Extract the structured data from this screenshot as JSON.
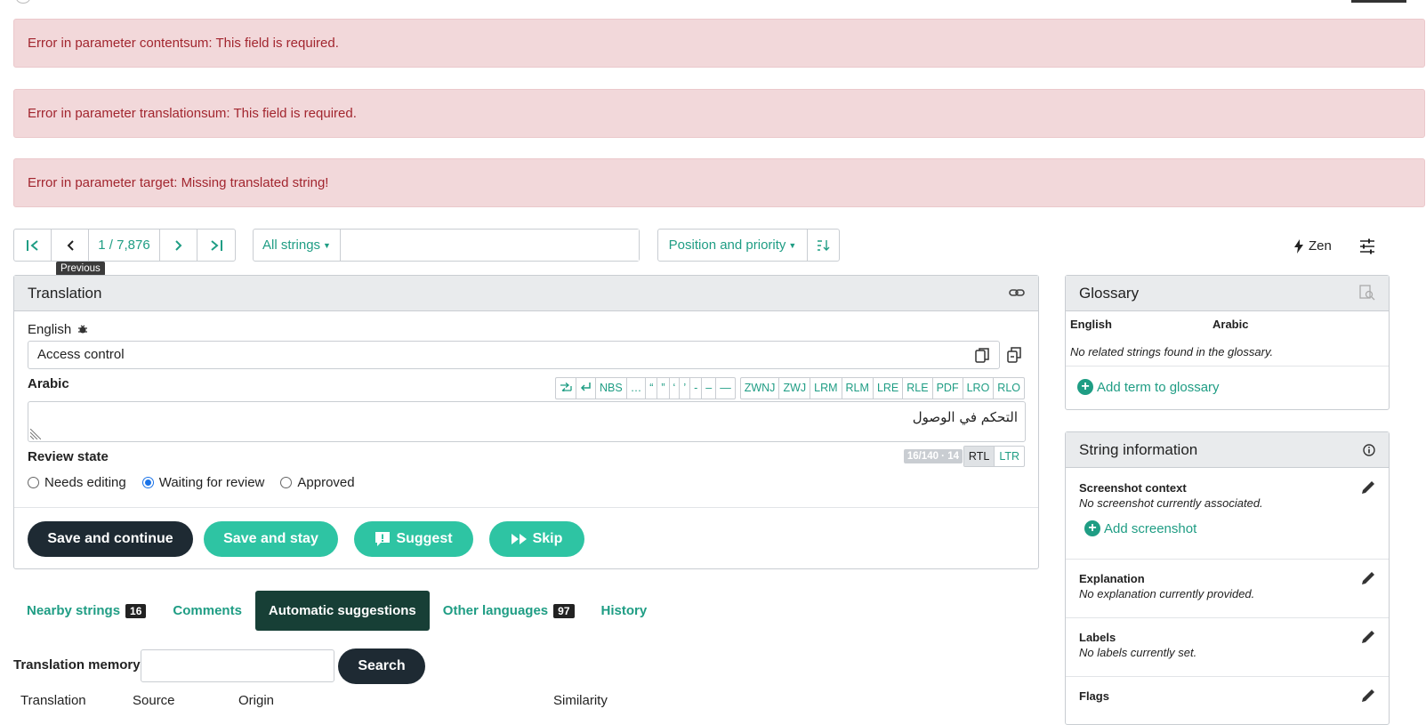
{
  "alerts": [
    "Error in parameter contentsum: This field is required.",
    "Error in parameter translationsum: This field is required.",
    "Error in parameter target: Missing translated string!"
  ],
  "pager": {
    "position": "1 / 7,876",
    "tooltip": "Previous"
  },
  "filter": {
    "label": "All strings",
    "query": ""
  },
  "sort": {
    "label": "Position and priority"
  },
  "zen": {
    "label": "Zen"
  },
  "translation": {
    "title": "Translation",
    "source_lang": "English",
    "source_text": "Access control",
    "target_lang": "Arabic",
    "target_text": "التحكم في الوصول",
    "special_chars": [
      "NBS",
      "…",
      "“",
      "”",
      "‘",
      "’",
      "-",
      "–",
      "—"
    ],
    "bidi_chars": [
      "ZWNJ",
      "ZWJ",
      "LRM",
      "RLM",
      "LRE",
      "RLE",
      "PDF",
      "LRO",
      "RLO"
    ],
    "counter": "16/140 · 14",
    "dir_rtl": "RTL",
    "dir_ltr": "LTR",
    "review_label": "Review state",
    "review_options": [
      "Needs editing",
      "Waiting for review",
      "Approved"
    ],
    "buttons": {
      "save_continue": "Save and continue",
      "save_stay": "Save and stay",
      "suggest": "Suggest",
      "skip": "Skip"
    }
  },
  "tabs": [
    {
      "label": "Nearby strings",
      "badge": "16"
    },
    {
      "label": "Comments",
      "badge": ""
    },
    {
      "label": "Automatic suggestions",
      "badge": ""
    },
    {
      "label": "Other languages",
      "badge": "97"
    },
    {
      "label": "History",
      "badge": ""
    }
  ],
  "memory": {
    "label": "Translation memory",
    "search_label": "Search",
    "columns": [
      "Translation",
      "Source",
      "Origin",
      "Similarity"
    ]
  },
  "glossary": {
    "title": "Glossary",
    "col_source": "English",
    "col_target": "Arabic",
    "empty": "No related strings found in the glossary.",
    "add": "Add term to glossary"
  },
  "info": {
    "title": "String information",
    "screenshot_title": "Screenshot context",
    "screenshot_value": "No screenshot currently associated.",
    "add_screenshot": "Add screenshot",
    "explanation_title": "Explanation",
    "explanation_value": "No explanation currently provided.",
    "labels_title": "Labels",
    "labels_value": "No labels currently set.",
    "flags_title": "Flags"
  },
  "colors": {
    "accent": "#1f9d84",
    "button_teal": "#2ec4a3",
    "button_dark": "#1e2a33",
    "alert_bg": "#f2d8da",
    "alert_text": "#a2262f"
  }
}
